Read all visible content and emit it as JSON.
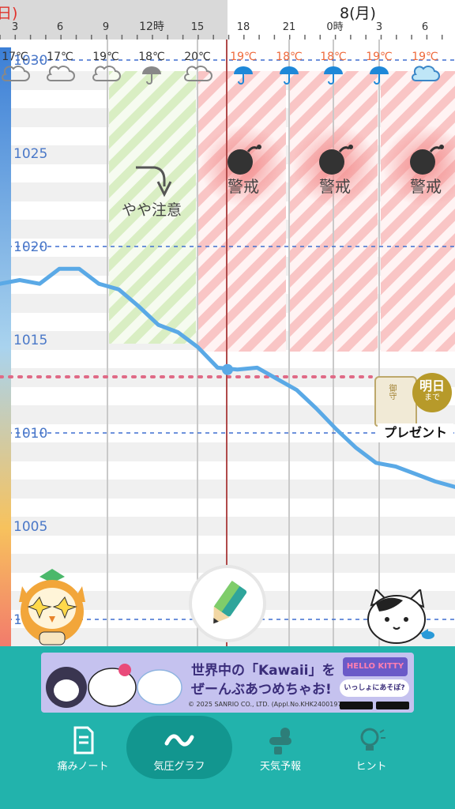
{
  "header": {
    "day_prev": "日)",
    "day_next": "8(月)",
    "hour_labels": [
      "3",
      "6",
      "9",
      "12時",
      "15",
      "18",
      "21",
      "0時",
      "3",
      "6"
    ]
  },
  "temperatures": [
    "17℃",
    "17℃",
    "19℃",
    "18℃",
    "20℃",
    "19℃",
    "18℃",
    "18℃",
    "19℃",
    "19℃"
  ],
  "weather_icons": [
    "cloud-icon",
    "cloud-icon",
    "cloud-icon",
    "umbrella-icon",
    "cloud-icon",
    "umbrella-icon",
    "umbrella-icon",
    "umbrella-icon",
    "umbrella-icon",
    "cloud-icon"
  ],
  "pressure_axis": [
    "1030",
    "1025",
    "1020",
    "1015",
    "1010",
    "1005",
    "1000"
  ],
  "zones": {
    "caution_label": "やや注意",
    "alert_label": "警戒"
  },
  "pressure_series": [
    1018,
    1018.2,
    1018.0,
    1018.8,
    1018.8,
    1018.0,
    1017.7,
    1016.8,
    1015.8,
    1015.4,
    1014.6,
    1013.5,
    1013.4,
    1013.5,
    1012.9,
    1012.3,
    1011.3,
    1010.2,
    1009.2,
    1008.4,
    1008.2,
    1007.8,
    1007.4,
    1007.1
  ],
  "current_pressure": 1013.4,
  "badge": {
    "line1": "明日",
    "line2": "まで",
    "present_label": "プレゼント",
    "omamori_label": "御守"
  },
  "banner": {
    "line1": "世界中の「Kawaii」を",
    "line2": "ぜーんぶあつめちゃお!",
    "copyright": "© 2025 SANRIO CO., LTD. (Appl.No.KHK24001977)",
    "cta": "いっしょにあそぼ?",
    "brand": "HELLO KITTY"
  },
  "nav": {
    "items": [
      {
        "label": "痛みノート",
        "icon": "notebook-icon"
      },
      {
        "label": "気圧グラフ",
        "icon": "wave-icon"
      },
      {
        "label": "天気予報",
        "icon": "weather-icon"
      },
      {
        "label": "ヒント",
        "icon": "lightbulb-icon"
      }
    ],
    "active_index": 1
  },
  "colors": {
    "accent": "#22b3ac",
    "line": "#5aa9e6",
    "alert": "#f08080",
    "caution": "#b6e08a",
    "rain": "#1e88d8"
  }
}
